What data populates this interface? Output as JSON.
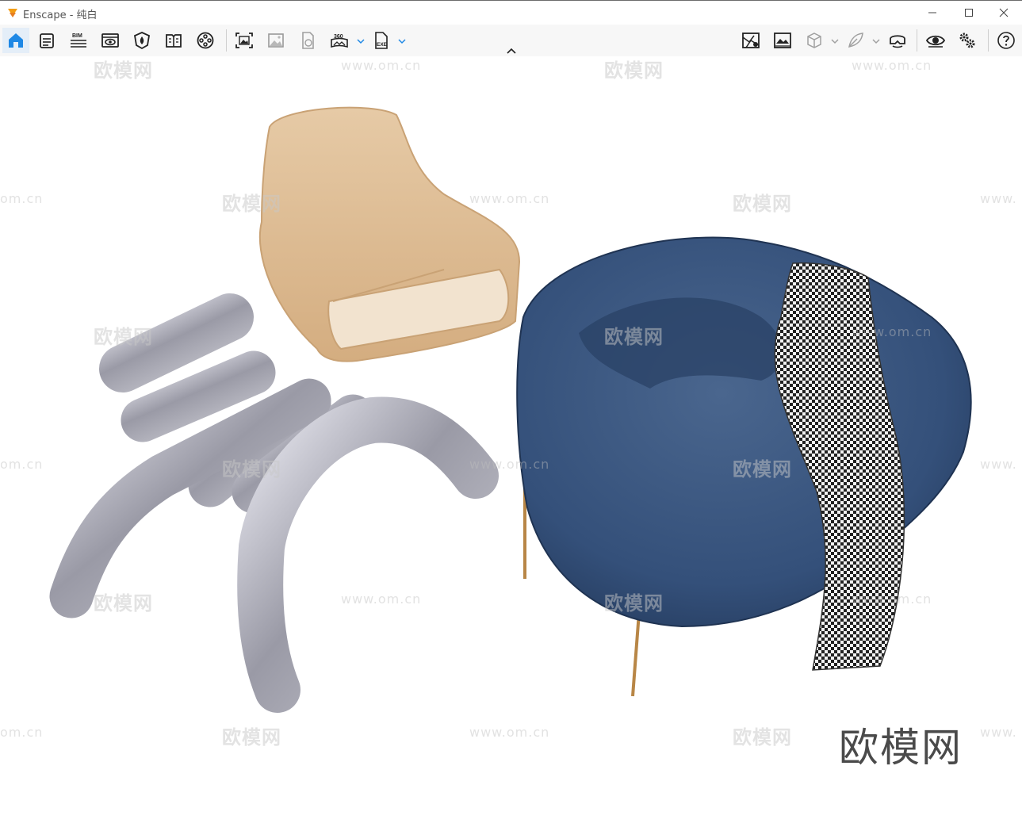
{
  "window": {
    "app_name": "Enscape",
    "title": "Enscape - 纯白",
    "controls": {
      "minimize": "—",
      "maximize": "☐",
      "close": "✕"
    }
  },
  "toolbar": {
    "left_icons": [
      "home-icon",
      "asset-library-icon",
      "bim-icon",
      "visual-settings-icon",
      "material-editor-icon",
      "views-icon",
      "video-editor-icon"
    ],
    "capture_icons": [
      "screenshot-icon",
      "batch-render-icon",
      "web-standalone-icon",
      "panorama-360-icon",
      "exe-export-icon"
    ],
    "right_icons": [
      "site-context-icon",
      "render-preview-icon",
      "cube-view-icon",
      "feather-icon",
      "vr-headset-icon",
      "eye-icon",
      "settings-icon",
      "help-icon"
    ],
    "bim_label": "BIM",
    "pano_label": "360",
    "exe_label": "EXE",
    "accent": "#1e88e5"
  },
  "watermarks": {
    "brand_small": "欧模网",
    "url": "www.om.cn",
    "partial_url": "om.cn",
    "partial_www": "www.",
    "brand_large": "欧模网"
  },
  "scene": {
    "objects": [
      "silver-tube-chair",
      "rattan-lounge-chair",
      "blue-velvet-armchair"
    ]
  }
}
